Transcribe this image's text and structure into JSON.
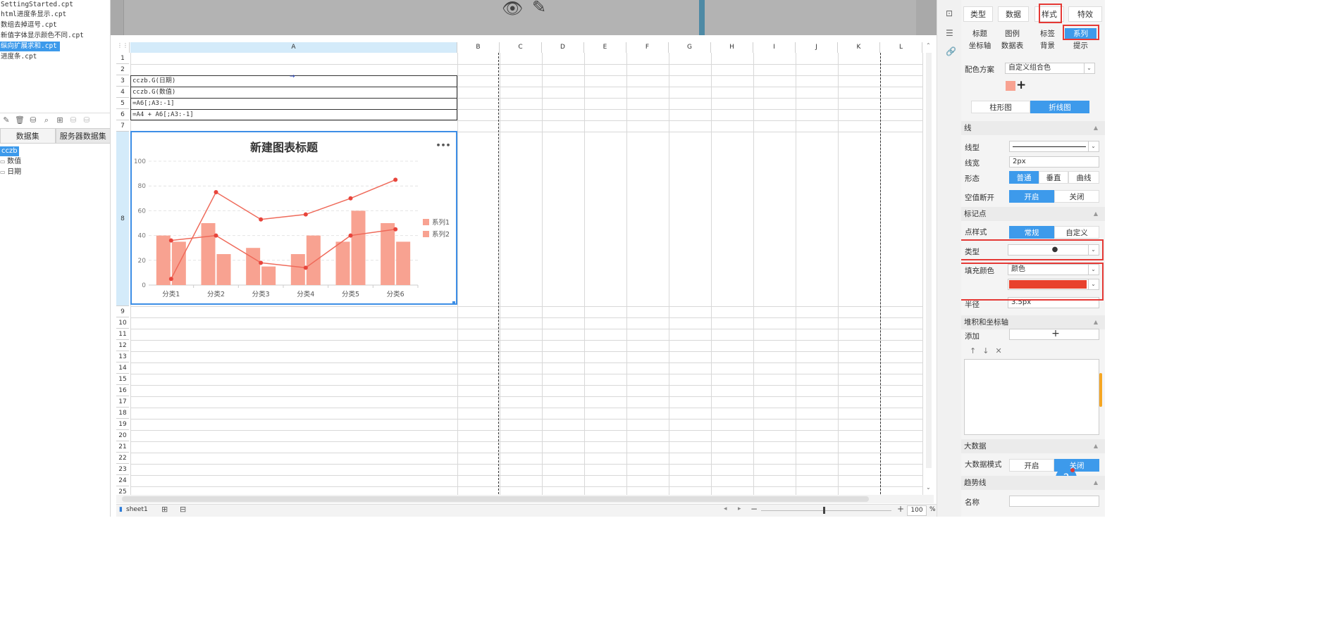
{
  "files": [
    "SettingStarted.cpt",
    "html进度条显示.cpt",
    "数组去掉逗号.cpt",
    "新值字体显示颜色不同.cpt",
    "纵向扩展求和.cpt",
    "进度条.cpt"
  ],
  "selected_file": 4,
  "dataset_tabs": [
    "数据集",
    "服务器数据集"
  ],
  "tree": {
    "root": "cczb",
    "fields": [
      "数值",
      "日期"
    ]
  },
  "columns": [
    "A",
    "B",
    "C",
    "D",
    "E",
    "F",
    "G",
    "H",
    "I",
    "J",
    "K",
    "L"
  ],
  "rows": [
    "1",
    "2",
    "3",
    "4",
    "5",
    "6",
    "7",
    "8",
    "9",
    "10",
    "11",
    "12",
    "13",
    "14",
    "15",
    "16",
    "17",
    "18",
    "19",
    "20",
    "21",
    "22",
    "23",
    "24",
    "25"
  ],
  "cells": {
    "a3": "cczb.G(日期)",
    "a4": "cczb.G(数值)",
    "a5": "=A6[;A3:-1]",
    "a6": "=A4 + A6[;A3:-1]"
  },
  "sheet_tab": "sheet1",
  "zoom": "100",
  "zoom_pct": "%",
  "chart_data": {
    "type": "bar",
    "title": "新建图表标题",
    "menu": "•••",
    "categories": [
      "分类1",
      "分类2",
      "分类3",
      "分类4",
      "分类5",
      "分类6"
    ],
    "ylim": [
      0,
      100
    ],
    "yticks": [
      "0",
      "20",
      "40",
      "60",
      "80",
      "100"
    ],
    "series": [
      {
        "name": "系列1",
        "type": "bar",
        "values": [
          40,
          50,
          30,
          25,
          35,
          50
        ]
      },
      {
        "name": "系列2",
        "type": "bar",
        "values": [
          35,
          25,
          15,
          40,
          60,
          35
        ]
      },
      {
        "name": "",
        "type": "line",
        "values": [
          5,
          75,
          53,
          57,
          70,
          85
        ]
      },
      {
        "name": "",
        "type": "line",
        "values": [
          36,
          40,
          18,
          14,
          40,
          45
        ]
      }
    ],
    "legend": "right",
    "colors": {
      "bar": "#f8a291",
      "line": "#ef6a5a",
      "dot": "#e8453c"
    }
  },
  "panel": {
    "main_tabs": [
      "类型",
      "数据",
      "样式",
      "特效"
    ],
    "sub_tabs_row1": [
      "标题",
      "图例",
      "标签",
      "系列"
    ],
    "sub_tabs_row2": [
      "坐标轴",
      "数据表",
      "背景",
      "提示"
    ],
    "color_scheme_label": "配色方案",
    "color_scheme_value": "自定义组合色",
    "add_color": "+",
    "chart_toggle": [
      "柱形图",
      "折线图"
    ],
    "sec_line": "线",
    "line_type_label": "线型",
    "line_width_label": "线宽",
    "line_width_value": "2px",
    "shape_label": "形态",
    "shape_options": [
      "普通",
      "垂直",
      "曲线"
    ],
    "null_break_label": "空值断开",
    "null_break_options": [
      "开启",
      "关闭"
    ],
    "sec_marker": "标记点",
    "point_style_label": "点样式",
    "point_style_options": [
      "常规",
      "自定义"
    ],
    "type_label": "类型",
    "type_value": "●",
    "fill_color_label": "填充颜色",
    "fill_color_value": "颜色",
    "fill_color_hex": "#e8412d",
    "radius_label": "半径",
    "radius_value": "3.5px",
    "sec_stack": "堆积和坐标轴",
    "add_label": "添加",
    "add_plus": "+",
    "list_tools": [
      "↑",
      "↓",
      "✕"
    ],
    "sec_bigdata": "大数据",
    "bigdata_label": "大数据模式",
    "bigdata_options": [
      "开启",
      "关闭"
    ],
    "sec_trend": "趋势线",
    "name_label": "名称",
    "help": "?"
  }
}
